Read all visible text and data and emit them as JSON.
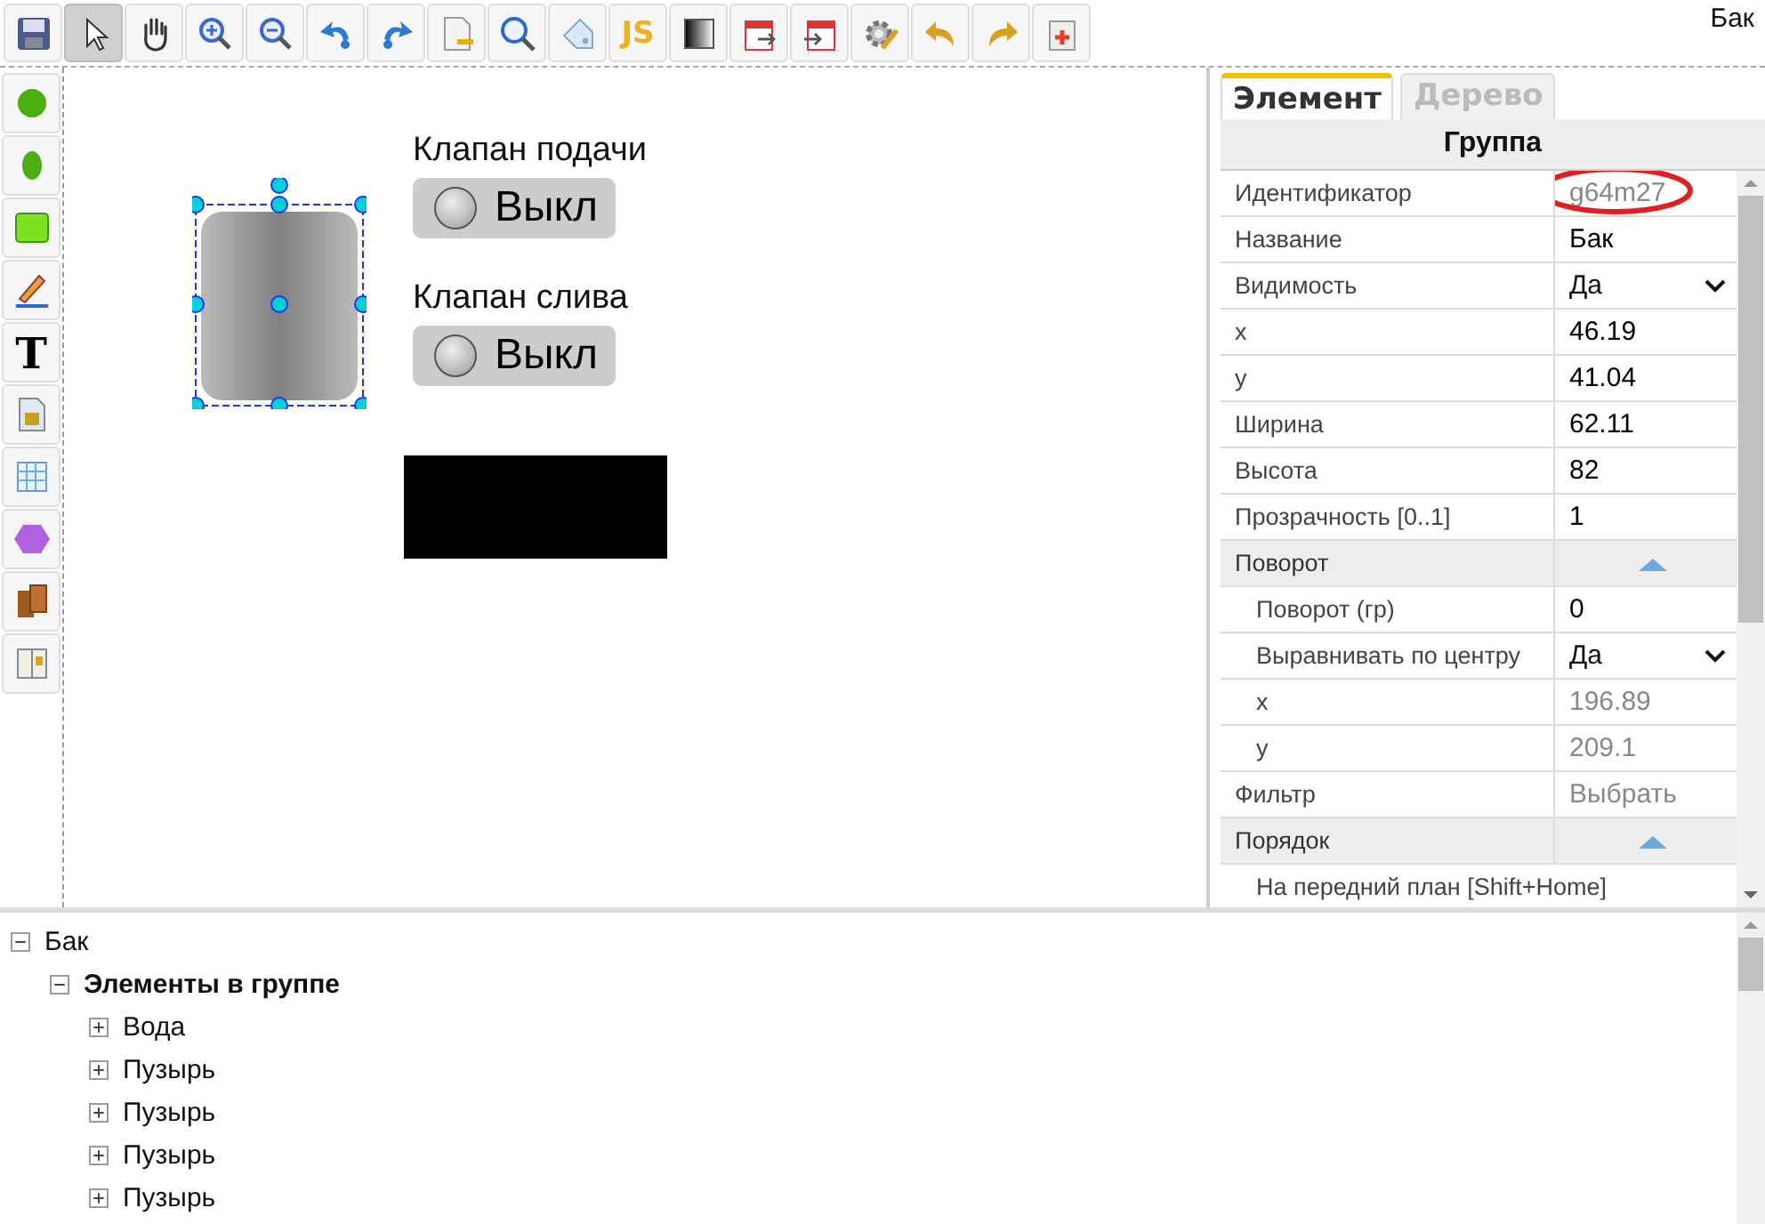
{
  "window": {
    "title": "Бак"
  },
  "toolbar": [
    {
      "kind": "save",
      "selected": false
    },
    {
      "kind": "pointer",
      "selected": true
    },
    {
      "kind": "hand",
      "selected": false
    },
    {
      "kind": "zoom-in",
      "selected": false
    },
    {
      "kind": "zoom-out",
      "selected": false
    },
    {
      "kind": "rotate-left",
      "selected": false
    },
    {
      "kind": "rotate-right",
      "selected": false
    },
    {
      "kind": "page",
      "selected": false
    },
    {
      "kind": "search",
      "selected": false
    },
    {
      "kind": "tag",
      "selected": false
    },
    {
      "kind": "script",
      "label": "JS",
      "selected": false
    },
    {
      "kind": "gradient",
      "selected": false
    },
    {
      "kind": "calendar-out",
      "selected": false
    },
    {
      "kind": "calendar-in",
      "selected": false
    },
    {
      "kind": "gear",
      "selected": false
    },
    {
      "kind": "undo",
      "selected": false
    },
    {
      "kind": "redo",
      "selected": false
    },
    {
      "kind": "paste",
      "selected": false
    }
  ],
  "palette": [
    {
      "kind": "circle"
    },
    {
      "kind": "ellipse"
    },
    {
      "kind": "rect"
    },
    {
      "kind": "pencil"
    },
    {
      "kind": "text",
      "label": "T"
    },
    {
      "kind": "image"
    },
    {
      "kind": "table"
    },
    {
      "kind": "hexagon"
    },
    {
      "kind": "books"
    },
    {
      "kind": "book"
    }
  ],
  "canvas": {
    "switches": [
      {
        "label": "Клапан подачи",
        "value": "Выкл",
        "on": false
      },
      {
        "label": "Клапан слива",
        "value": "Выкл",
        "on": false
      }
    ]
  },
  "inspector": {
    "tabs": [
      {
        "label": "Элемент",
        "selected": true
      },
      {
        "label": "Дерево",
        "selected": false
      }
    ],
    "header": "Группа",
    "rows": [
      {
        "kind": "text",
        "label": "Идентификатор",
        "value": "g64m27",
        "disabled": true,
        "circled": true
      },
      {
        "kind": "text",
        "label": "Название",
        "value": "Бак",
        "disabled": false,
        "circled": false
      },
      {
        "kind": "select",
        "label": "Видимость",
        "value": "Да"
      },
      {
        "kind": "text",
        "label": "x",
        "value": "46.19",
        "disabled": false,
        "circled": false
      },
      {
        "kind": "text",
        "label": "y",
        "value": "41.04",
        "disabled": false,
        "circled": false
      },
      {
        "kind": "text",
        "label": "Ширина",
        "value": "62.11",
        "disabled": false,
        "circled": false
      },
      {
        "kind": "text",
        "label": "Высота",
        "value": "82",
        "disabled": false,
        "circled": false
      },
      {
        "kind": "text",
        "label": "Прозрачность [0..1]",
        "value": "1",
        "disabled": false,
        "circled": false
      },
      {
        "kind": "section",
        "label": "Поворот",
        "expanded": true,
        "children": [
          {
            "kind": "text",
            "label": "Поворот (гр)",
            "value": "0",
            "disabled": false,
            "circled": false
          },
          {
            "kind": "select",
            "label": "Выравнивать по центру",
            "value": "Да"
          },
          {
            "kind": "text",
            "label": "x",
            "value": "196.89",
            "disabled": true,
            "circled": false
          },
          {
            "kind": "text",
            "label": "y",
            "value": "209.1",
            "disabled": true,
            "circled": false
          }
        ]
      },
      {
        "kind": "text",
        "label": "Фильтр",
        "value": "Выбрать",
        "disabled": true,
        "circled": false
      },
      {
        "kind": "section",
        "label": "Порядок",
        "expanded": true,
        "children": [
          {
            "kind": "action",
            "label": "На передний план [Shift+Home]"
          }
        ]
      }
    ]
  },
  "tree": [
    {
      "label": "Бак",
      "bold": false,
      "expanded": true,
      "children": [
        {
          "label": "Элементы в группе",
          "bold": true,
          "expanded": true,
          "children": [
            {
              "label": "Вода",
              "bold": false,
              "expanded": false
            },
            {
              "label": "Пузырь",
              "bold": false,
              "expanded": false
            },
            {
              "label": "Пузырь",
              "bold": false,
              "expanded": false
            },
            {
              "label": "Пузырь",
              "bold": false,
              "expanded": false
            },
            {
              "label": "Пузырь",
              "bold": false,
              "expanded": false
            }
          ]
        }
      ]
    }
  ]
}
